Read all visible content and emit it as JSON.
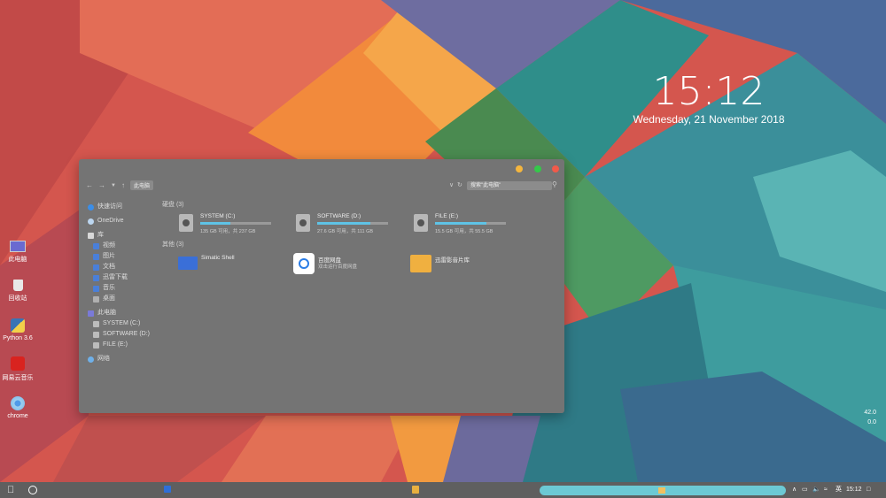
{
  "clock": {
    "time": "15:12",
    "date": "Wednesday, 21 November 2018"
  },
  "desktop_icons": [
    {
      "label": "此电脑",
      "icon": "computer-icon"
    },
    {
      "label": "回收站",
      "icon": "recycle-bin-icon"
    },
    {
      "label": "Python 3.6",
      "icon": "python-icon"
    },
    {
      "label": "网易云音乐",
      "icon": "netease-music-icon"
    },
    {
      "label": "chrome",
      "icon": "chrome-icon"
    }
  ],
  "explorer": {
    "address": "此电脑",
    "search_placeholder": "搜索\"此电脑\"",
    "sidebar": [
      {
        "label": "快速访问",
        "icon": "star-icon"
      },
      {
        "label": "OneDrive",
        "icon": "cloud-icon"
      },
      {
        "label": "库",
        "icon": "library-icon"
      },
      {
        "label": "视频",
        "icon": "video-folder-icon"
      },
      {
        "label": "图片",
        "icon": "picture-folder-icon"
      },
      {
        "label": "文档",
        "icon": "document-folder-icon"
      },
      {
        "label": "迅雷下载",
        "icon": "download-folder-icon"
      },
      {
        "label": "音乐",
        "icon": "music-folder-icon"
      },
      {
        "label": "桌面",
        "icon": "desktop-folder-icon"
      },
      {
        "label": "此电脑",
        "icon": "computer-icon"
      },
      {
        "label": "SYSTEM (C:)",
        "icon": "drive-icon"
      },
      {
        "label": "SOFTWARE (D:)",
        "icon": "drive-icon"
      },
      {
        "label": "FILE (E:)",
        "icon": "drive-icon"
      },
      {
        "label": "网络",
        "icon": "network-icon"
      }
    ],
    "drives_heading": "硬盘 (3)",
    "drives": [
      {
        "name": "SYSTEM (C:)",
        "size": "135 GB 可用，共 237 GB",
        "used_fraction": 0.43
      },
      {
        "name": "SOFTWARE (D:)",
        "size": "27.6 GB 可用，共 111 GB",
        "used_fraction": 0.75
      },
      {
        "name": "FILE (E:)",
        "size": "15.5 GB 可用，共 55.5 GB",
        "used_fraction": 0.72
      }
    ],
    "other_heading": "其他 (3)",
    "others": [
      {
        "name": "Simatic Shell",
        "sub": "",
        "icon": "blue-folder-icon"
      },
      {
        "name": "百度网盘",
        "sub": "双击运行百度网盘",
        "icon": "baidu-netdisk-icon"
      },
      {
        "name": "迅雷影音片库",
        "sub": "",
        "icon": "xunlei-folder-icon"
      }
    ]
  },
  "taskbar": {
    "tray_lang": "英",
    "tray_time": "15:12"
  },
  "side_note": {
    "line1": "42.0",
    "line2": "0.0"
  },
  "colors": {
    "window_bg": "#747474",
    "progress": "#5ec3e6",
    "taskbar": "#5f5f5f",
    "taskbar_pill": "#6cc9d4"
  }
}
